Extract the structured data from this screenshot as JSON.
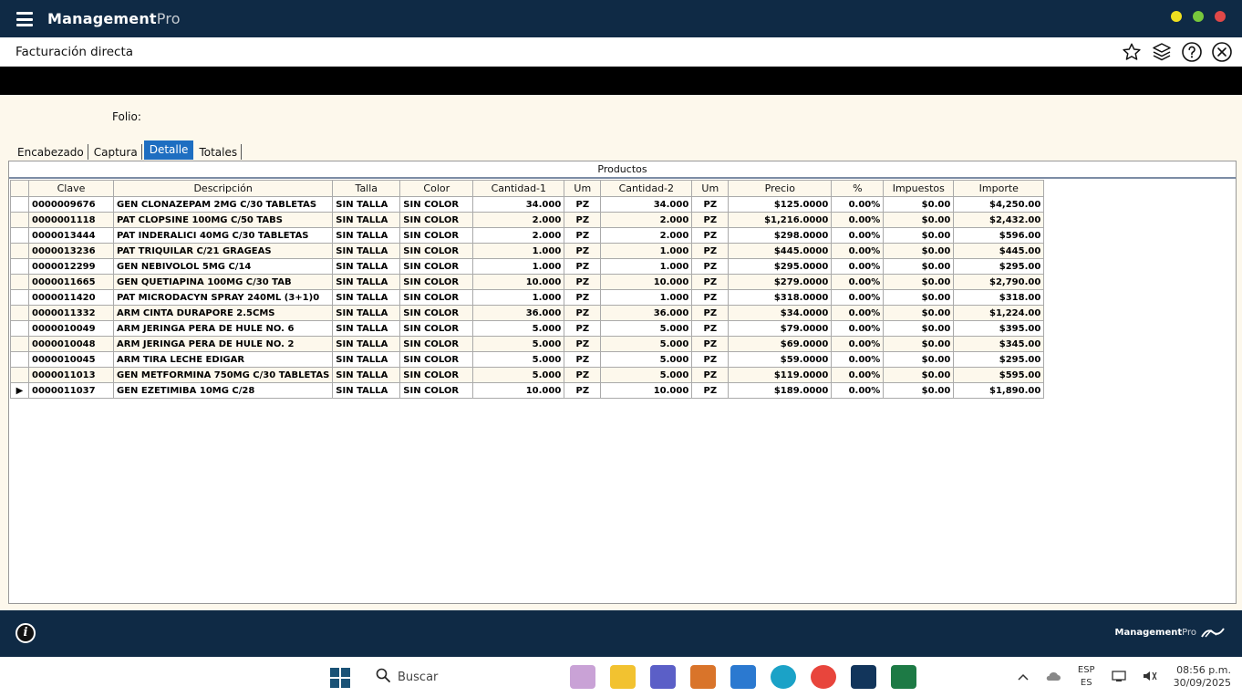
{
  "app": {
    "title_main": "Management",
    "title_suffix": "Pro",
    "window_dots": [
      "#f0e020",
      "#78c83c",
      "#e04848"
    ]
  },
  "header": {
    "page_title": "Facturación directa",
    "icons": [
      "star-icon",
      "layers-icon",
      "help-icon",
      "close-icon"
    ]
  },
  "form": {
    "folio_label": "Folio:"
  },
  "tabs": [
    {
      "label": "Encabezado",
      "active": false
    },
    {
      "label": "Captura",
      "active": false
    },
    {
      "label": "Detalle",
      "active": true
    },
    {
      "label": "Totales",
      "active": false
    }
  ],
  "grid": {
    "title": "Productos",
    "columns": [
      "Clave",
      "Descripción",
      "Talla",
      "Color",
      "Cantidad-1",
      "Um",
      "Cantidad-2",
      "Um",
      "Precio",
      "%",
      "Impuestos",
      "Importe"
    ],
    "rows": [
      [
        "0000009676",
        "GEN CLONAZEPAM 2MG C/30 TABLETAS",
        "SIN TALLA",
        "SIN COLOR",
        "34.000",
        "PZ",
        "34.000",
        "PZ",
        "$125.0000",
        "0.00%",
        "$0.00",
        "$4,250.00"
      ],
      [
        "0000001118",
        "PAT CLOPSINE 100MG C/50 TABS",
        "SIN TALLA",
        "SIN COLOR",
        "2.000",
        "PZ",
        "2.000",
        "PZ",
        "$1,216.0000",
        "0.00%",
        "$0.00",
        "$2,432.00"
      ],
      [
        "0000013444",
        "PAT INDERALICI 40MG C/30 TABLETAS",
        "SIN TALLA",
        "SIN COLOR",
        "2.000",
        "PZ",
        "2.000",
        "PZ",
        "$298.0000",
        "0.00%",
        "$0.00",
        "$596.00"
      ],
      [
        "0000013236",
        "PAT TRIQUILAR C/21 GRAGEAS",
        "SIN TALLA",
        "SIN COLOR",
        "1.000",
        "PZ",
        "1.000",
        "PZ",
        "$445.0000",
        "0.00%",
        "$0.00",
        "$445.00"
      ],
      [
        "0000012299",
        "GEN NEBIVOLOL 5MG C/14",
        "SIN TALLA",
        "SIN COLOR",
        "1.000",
        "PZ",
        "1.000",
        "PZ",
        "$295.0000",
        "0.00%",
        "$0.00",
        "$295.00"
      ],
      [
        "0000011665",
        "GEN QUETIAPINA 100MG C/30 TAB",
        "SIN TALLA",
        "SIN COLOR",
        "10.000",
        "PZ",
        "10.000",
        "PZ",
        "$279.0000",
        "0.00%",
        "$0.00",
        "$2,790.00"
      ],
      [
        "0000011420",
        "PAT MICRODACYN SPRAY 240ML (3+1)0",
        "SIN TALLA",
        "SIN COLOR",
        "1.000",
        "PZ",
        "1.000",
        "PZ",
        "$318.0000",
        "0.00%",
        "$0.00",
        "$318.00"
      ],
      [
        "0000011332",
        "ARM CINTA DURAPORE 2.5CMS",
        "SIN TALLA",
        "SIN COLOR",
        "36.000",
        "PZ",
        "36.000",
        "PZ",
        "$34.0000",
        "0.00%",
        "$0.00",
        "$1,224.00"
      ],
      [
        "0000010049",
        "ARM JERINGA PERA DE HULE NO. 6",
        "SIN TALLA",
        "SIN COLOR",
        "5.000",
        "PZ",
        "5.000",
        "PZ",
        "$79.0000",
        "0.00%",
        "$0.00",
        "$395.00"
      ],
      [
        "0000010048",
        "ARM JERINGA PERA DE HULE NO. 2",
        "SIN TALLA",
        "SIN COLOR",
        "5.000",
        "PZ",
        "5.000",
        "PZ",
        "$69.0000",
        "0.00%",
        "$0.00",
        "$345.00"
      ],
      [
        "0000010045",
        "ARM TIRA LECHE EDIGAR",
        "SIN TALLA",
        "SIN COLOR",
        "5.000",
        "PZ",
        "5.000",
        "PZ",
        "$59.0000",
        "0.00%",
        "$0.00",
        "$295.00"
      ],
      [
        "0000011013",
        "GEN METFORMINA 750MG C/30 TABLETAS",
        "SIN TALLA",
        "SIN COLOR",
        "5.000",
        "PZ",
        "5.000",
        "PZ",
        "$119.0000",
        "0.00%",
        "$0.00",
        "$595.00"
      ],
      [
        "0000011037",
        "GEN EZETIMIBA 10MG C/28",
        "SIN TALLA",
        "SIN COLOR",
        "10.000",
        "PZ",
        "10.000",
        "PZ",
        "$189.0000",
        "0.00%",
        "$0.00",
        "$1,890.00"
      ]
    ],
    "current_row": 12
  },
  "footer": {
    "logo_main": "Management",
    "logo_suffix": "Pro"
  },
  "taskbar": {
    "search_placeholder": "Buscar",
    "lang_top": "ESP",
    "lang_bottom": "ES",
    "time": "08:56 p.m.",
    "date": "30/09/2025"
  }
}
